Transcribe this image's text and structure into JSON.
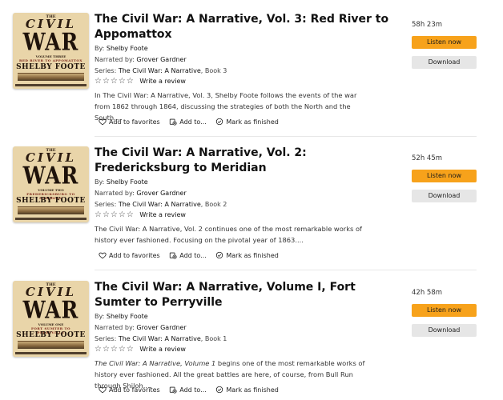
{
  "labels": {
    "by": "By:",
    "narrated_by": "Narrated by:",
    "series": "Series:",
    "stars": "☆☆☆☆☆",
    "write_review": "Write a review",
    "add_favorites": "Add to favorites",
    "add_to": "Add to...",
    "mark_finished": "Mark as finished",
    "listen_now": "Listen now",
    "download": "Download"
  },
  "items": [
    {
      "title": "The Civil War: A Narrative, Vol. 3: Red River to Appomattox",
      "author": "Shelby Foote",
      "narrator": "Grover Gardner",
      "series": "The Civil War: A Narrative",
      "book": ", Book 3",
      "description": "In The Civil War: A Narrative, Vol. 3, Shelby Foote follows the events of the war from 1862 through 1864, discussing the strategies of both the North and the South....",
      "description_italic": "",
      "duration": "58h 23m",
      "cover": {
        "the": "THE",
        "civil": "CIVIL",
        "war": "WAR",
        "volume": "VOLUME THREE",
        "subtitle": "RED RIVER TO APPOMATTOX",
        "author": "SHELBY FOOTE"
      }
    },
    {
      "title": "The Civil War: A Narrative, Vol. 2: Fredericksburg to Meridian",
      "author": "Shelby Foote",
      "narrator": "Grover Gardner",
      "series": "The Civil War: A Narrative",
      "book": ", Book 2",
      "description": "The Civil War: A Narrative, Vol. 2 continues one of the most remarkable works of history ever fashioned. Focusing on the pivotal year of 1863....",
      "description_italic": "",
      "duration": "52h 45m",
      "cover": {
        "the": "THE",
        "civil": "CIVIL",
        "war": "WAR",
        "volume": "VOLUME TWO",
        "subtitle": "FREDERICKSBURG TO MERIDIAN",
        "author": "SHELBY FOOTE"
      }
    },
    {
      "title": "The Civil War: A Narrative, Volume I, Fort Sumter to Perryville",
      "author": "Shelby Foote",
      "narrator": "Grover Gardner",
      "series": "The Civil War: A Narrative",
      "book": ", Book 1",
      "description": " begins one of the most remarkable works of history ever fashioned. All the great battles are here, of course, from Bull Run through Shiloh....",
      "description_italic": "The Civil War: A Narrative, Volume 1",
      "duration": "42h 58m",
      "cover": {
        "the": "THE",
        "civil": "CIVIL",
        "war": "WAR",
        "volume": "VOLUME ONE",
        "subtitle": "FORT SUMTER TO PERRYVILLE",
        "author": "SHELBY FOOTE"
      }
    }
  ],
  "colors": {
    "accent": "#f7a21b",
    "secondary": "#e6e6e6",
    "separator": "#e7e7e7"
  }
}
